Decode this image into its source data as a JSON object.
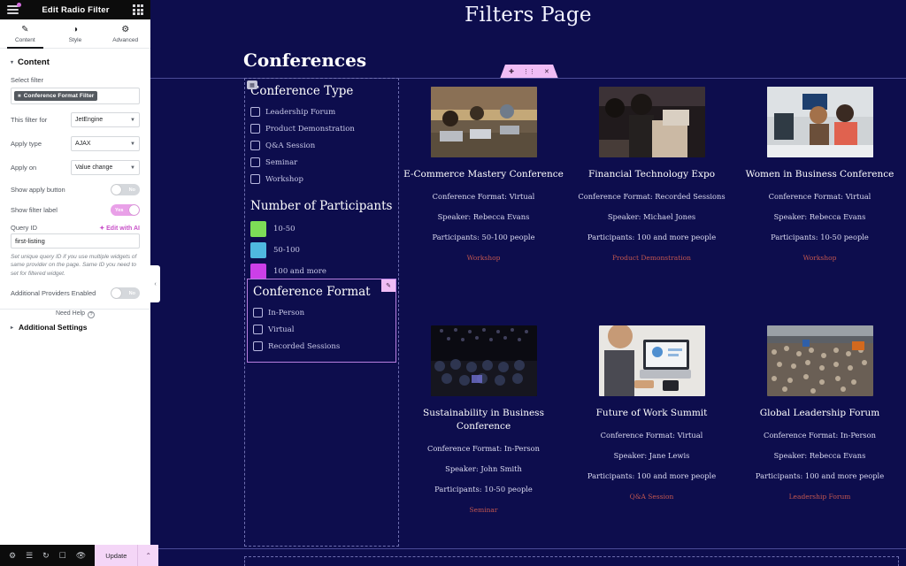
{
  "panel": {
    "header": {
      "title": "Edit Radio Filter",
      "menu_icon": "hamburger-icon",
      "apps_icon": "grid-icon"
    },
    "tabs": [
      {
        "label": "Content",
        "icon": "pencil-icon",
        "active": true
      },
      {
        "label": "Style",
        "icon": "contrast-icon",
        "active": false
      },
      {
        "label": "Advanced",
        "icon": "gear-icon",
        "active": false
      }
    ],
    "content_section": {
      "label": "Content",
      "caret": "▾"
    },
    "select_filter": {
      "label": "Select filter",
      "tag": "Conference Format Filter"
    },
    "this_filter_for": {
      "label": "This filter for",
      "value": "JetEngine"
    },
    "apply_type": {
      "label": "Apply type",
      "value": "AJAX"
    },
    "apply_on": {
      "label": "Apply on",
      "value": "Value change"
    },
    "show_apply_button": {
      "label": "Show apply button",
      "value": "No",
      "state": "off"
    },
    "show_filter_label": {
      "label": "Show filter label",
      "value": "Yes",
      "state": "on"
    },
    "query_id": {
      "label": "Query ID",
      "ai_link": "Edit with AI",
      "value": "first-listing",
      "helper": "Set unique query ID if you use multiple widgets of same provider on the page. Same ID you need to set for filtered widget."
    },
    "additional_providers": {
      "label": "Additional Providers Enabled",
      "value": "No",
      "state": "off"
    },
    "additional_settings": {
      "label": "Additional Settings",
      "caret": "▸"
    },
    "need_help": {
      "label": "Need Help",
      "icon": "question-circle-icon"
    },
    "footer": {
      "icons": [
        "settings-gear-icon",
        "layers-icon",
        "history-icon",
        "responsive-icon",
        "preview-eye-icon"
      ],
      "update_label": "Update",
      "update_caret": "⌃"
    },
    "collapse_handle": "‹"
  },
  "canvas": {
    "page_title": "Filters Page",
    "heading": "Conferences",
    "element_toolbar": [
      "plus-icon",
      "drag-handle-icon",
      "close-icon"
    ],
    "filters": {
      "conference_type": {
        "title": "Conference Type",
        "options": [
          "Leadership Forum",
          "Product Demonstration",
          "Q&A Session",
          "Seminar",
          "Workshop"
        ]
      },
      "participants": {
        "title": "Number of Participants",
        "options": [
          {
            "label": "10-50",
            "color": "#7ddc57"
          },
          {
            "label": "50-100",
            "color": "#4fb8e0"
          },
          {
            "label": "100 and more",
            "color": "#cc3fe8"
          }
        ]
      },
      "conference_format": {
        "title": "Conference Format",
        "options": [
          "In-Person",
          "Virtual",
          "Recorded Sessions"
        ],
        "edit_icon": "pencil-icon"
      }
    },
    "cards": [
      {
        "title": "E-Commerce Mastery Conference",
        "format": "Conference Format: Virtual",
        "speaker": "Speaker: Rebecca Evans",
        "participants": "Participants: 50-100 people",
        "tag": "Workshop",
        "image": "people-working-on-laptops-at-table"
      },
      {
        "title": "Financial Technology Expo",
        "format": "Conference Format: Recorded Sessions",
        "speaker": "Speaker: Michael Jones",
        "participants": "Participants: 100 and more people",
        "tag": "Product Demonstration",
        "image": "seated-audience-taking-notes"
      },
      {
        "title": "Women in Business Conference",
        "format": "Conference Format: Virtual",
        "speaker": "Speaker: Rebecca Evans",
        "participants": "Participants: 10-50 people",
        "tag": "Workshop",
        "image": "two-women-at-office-desk"
      },
      {
        "title": "Sustainability in Business Conference",
        "format": "Conference Format: In-Person",
        "speaker": "Speaker: John Smith",
        "participants": "Participants: 10-50 people",
        "tag": "Seminar",
        "image": "dark-auditorium-crowd"
      },
      {
        "title": "Future of Work Summit",
        "format": "Conference Format: Virtual",
        "speaker": "Speaker: Jane Lewis",
        "participants": "Participants: 100 and more people",
        "tag": "Q&A Session",
        "image": "hands-typing-on-laptop-with-charts"
      },
      {
        "title": "Global Leadership Forum",
        "format": "Conference Format: In-Person",
        "speaker": "Speaker: Rebecca Evans",
        "participants": "Participants: 100 and more people",
        "tag": "Leadership Forum",
        "image": "aerial-view-of-large-crowd"
      }
    ]
  },
  "colors": {
    "canvas_bg": "#0d0d4d",
    "accent_pink": "#f0bdf5",
    "tag_red": "#c2564f",
    "ai_purple": "#c850c8"
  }
}
